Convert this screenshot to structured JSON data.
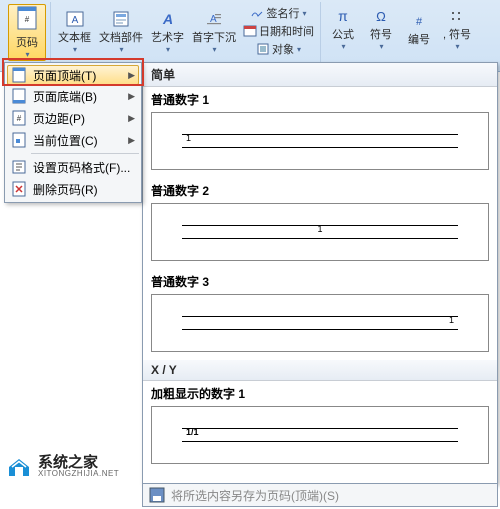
{
  "ribbon": {
    "page_number": {
      "label": "页码",
      "icon": "page-number-icon"
    },
    "text_box": {
      "label": "文本框"
    },
    "parts": {
      "label": "文档部件"
    },
    "wordart": {
      "label": "艺术字"
    },
    "drop_cap": {
      "label": "首字下沉"
    },
    "signature": {
      "label": "签名行"
    },
    "datetime": {
      "label": "日期和时间"
    },
    "object": {
      "label": "对象"
    },
    "equation": {
      "label": "公式"
    },
    "symbol": {
      "label": "符号"
    },
    "number": {
      "label": "编号"
    },
    "more_symbol": {
      "label": ", 符号"
    }
  },
  "dropdown": {
    "items": [
      {
        "label": "页面顶端(T)",
        "icon": "page-top-icon",
        "highlight": true,
        "arrow": true
      },
      {
        "label": "页面底端(B)",
        "icon": "page-bottom-icon",
        "arrow": true
      },
      {
        "label": "页边距(P)",
        "icon": "page-margin-icon",
        "arrow": true
      },
      {
        "label": "当前位置(C)",
        "icon": "current-pos-icon",
        "arrow": true
      },
      {
        "sep": true
      },
      {
        "label": "设置页码格式(F)...",
        "icon": "format-icon"
      },
      {
        "label": "删除页码(R)",
        "icon": "remove-icon"
      }
    ]
  },
  "gallery": {
    "categories": [
      {
        "header": "简单",
        "items": [
          {
            "label": "普通数字 1",
            "num": "1",
            "align": "left"
          },
          {
            "label": "普通数字 2",
            "num": "1",
            "align": "center"
          },
          {
            "label": "普通数字 3",
            "num": "1",
            "align": "right"
          }
        ]
      },
      {
        "header": "X / Y",
        "items": [
          {
            "label": "加粗显示的数字 1",
            "num": "1/1",
            "align": "left",
            "bold": true
          }
        ]
      }
    ],
    "save_label": "将所选内容另存为页码(顶端)(S)"
  },
  "watermark": {
    "zh": "系统之家",
    "en": "XITONGZHIJIA.NET"
  }
}
